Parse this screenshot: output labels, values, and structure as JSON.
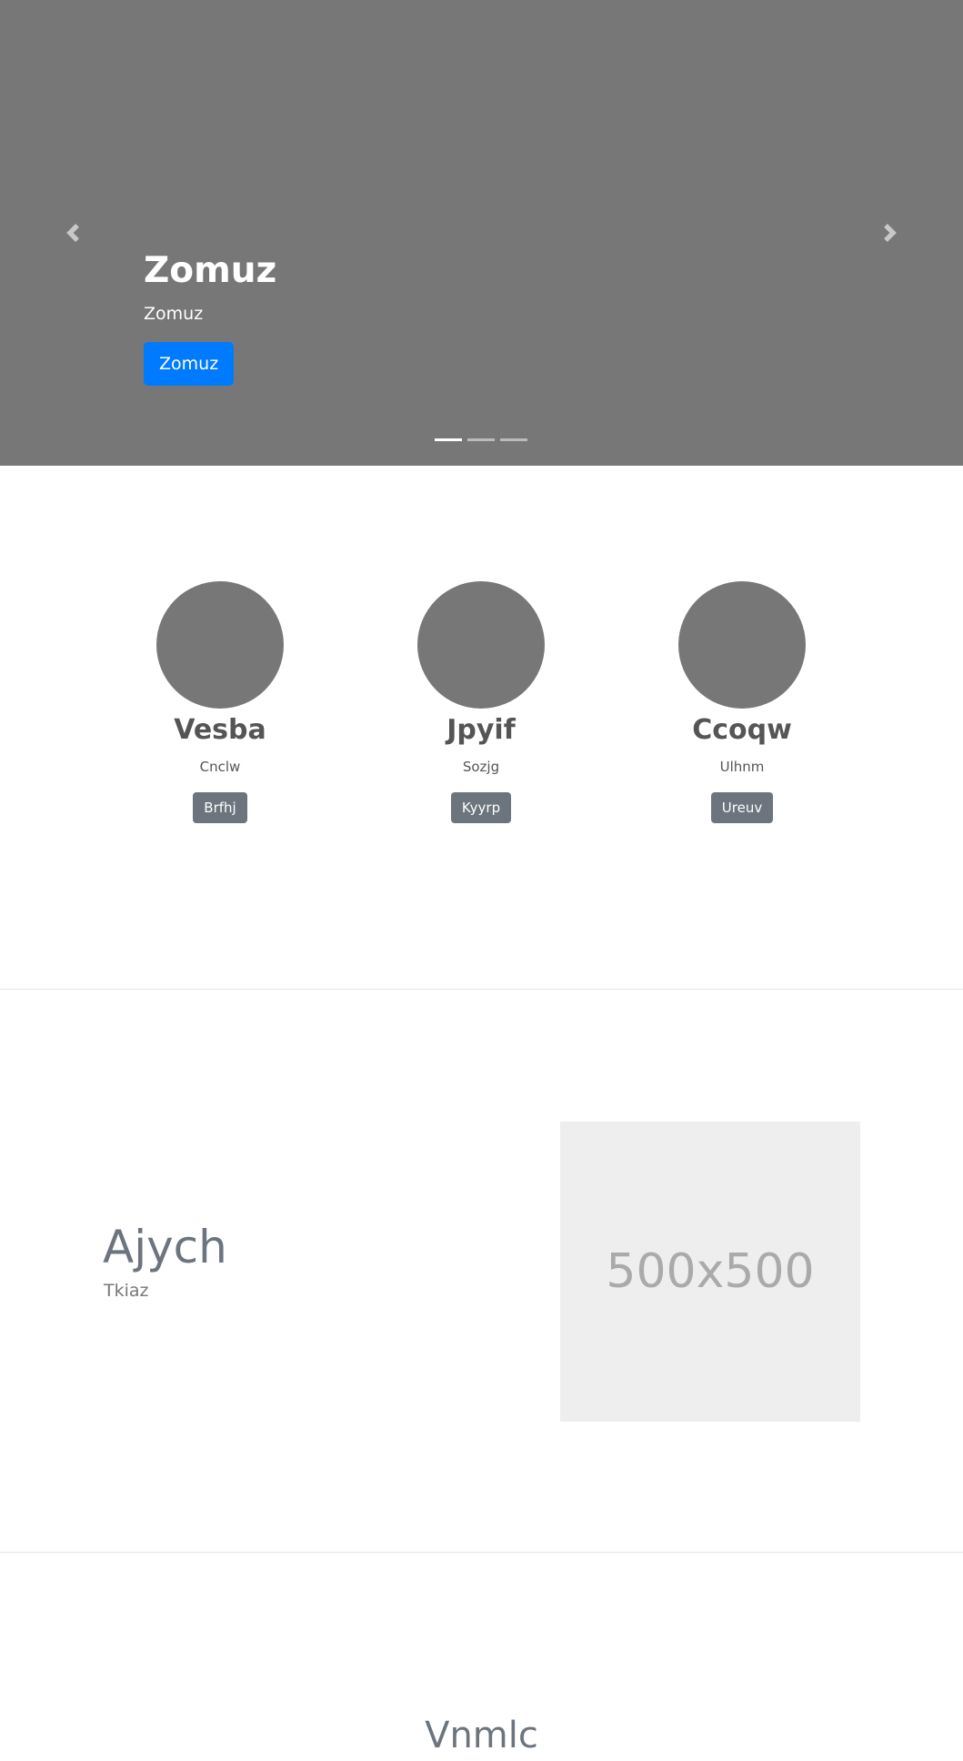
{
  "carousel": {
    "slide": {
      "heading": "Zomuz",
      "text": "Zomuz",
      "button_label": "Zomuz"
    },
    "indicators": [
      {
        "active": true
      },
      {
        "active": false
      },
      {
        "active": false
      }
    ],
    "prev_icon": "chevron-left-icon",
    "next_icon": "chevron-right-icon",
    "background_color": "#777777",
    "button_color": "#007bff"
  },
  "marketing": {
    "columns": [
      {
        "title": "Vesba",
        "subtitle": "Cnclw",
        "button_label": "Brfhj"
      },
      {
        "title": "Jpyif",
        "subtitle": "Sozjg",
        "button_label": "Kyyrp"
      },
      {
        "title": "Ccoqw",
        "subtitle": "Ulhnm",
        "button_label": "Ureuv"
      }
    ]
  },
  "featurette": {
    "heading": "Ajych",
    "text": "Tkiaz",
    "image_placeholder": "500x500"
  },
  "next_section": {
    "heading": "Vnmlc"
  }
}
